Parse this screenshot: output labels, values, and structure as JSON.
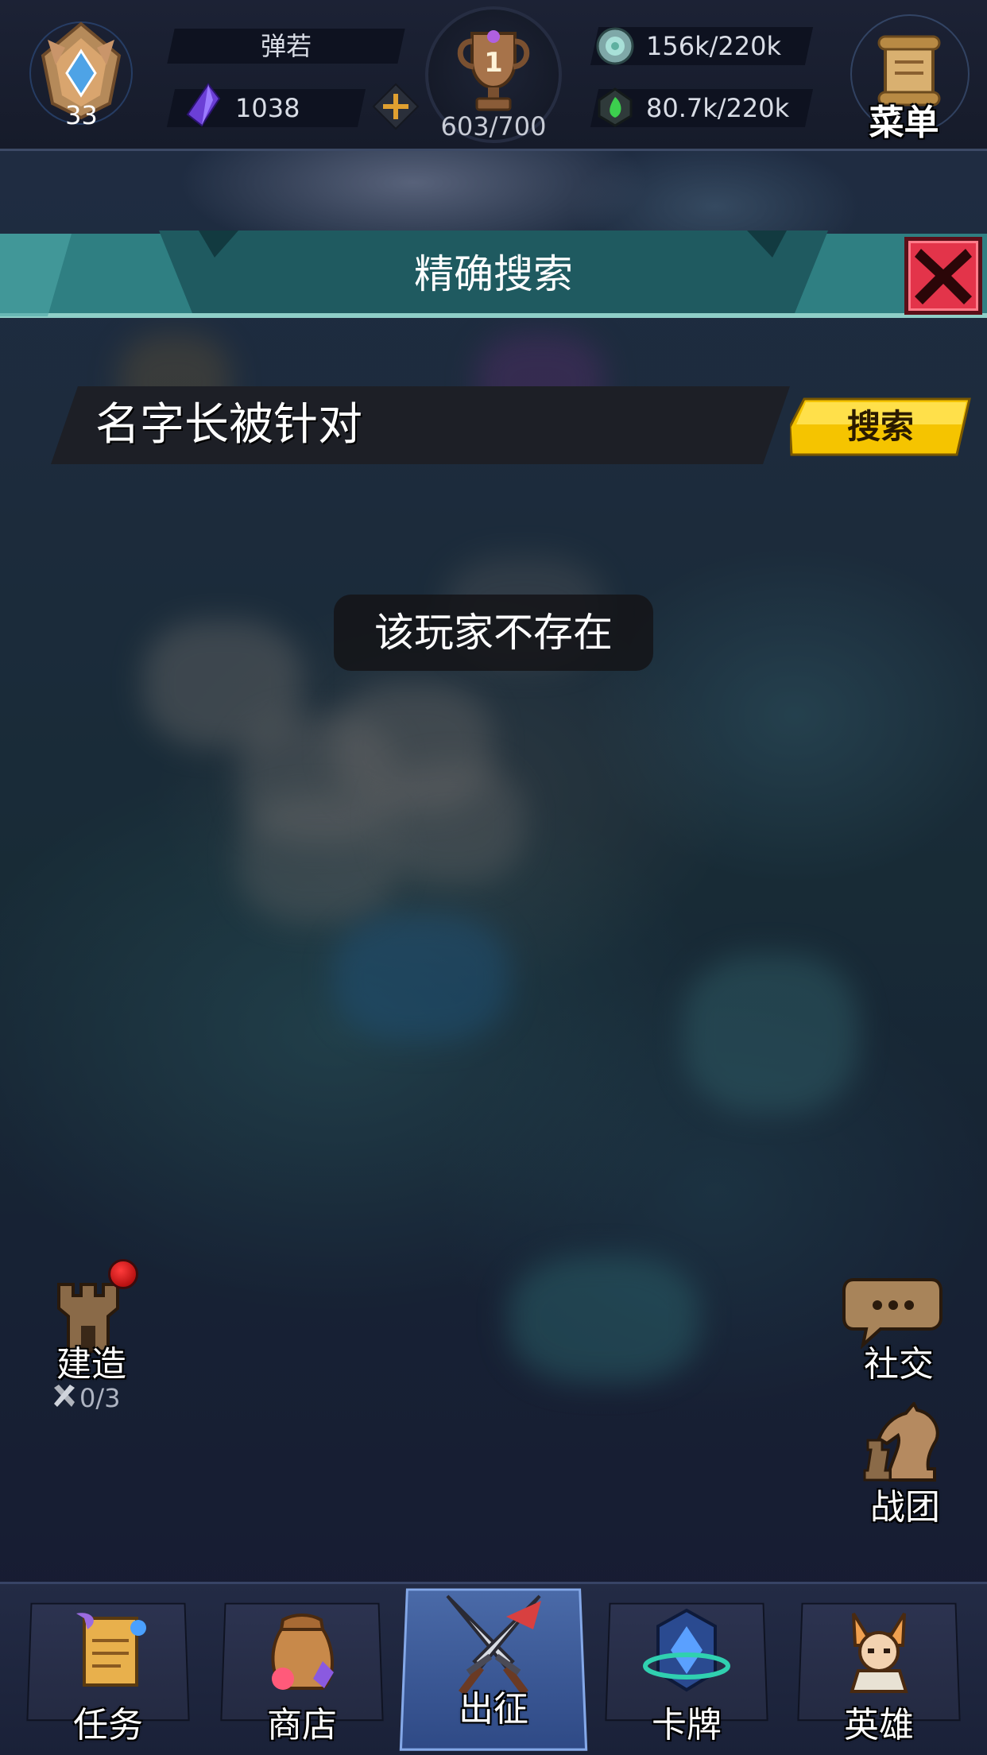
{
  "player": {
    "name": "弹若",
    "level": "33",
    "gems": "1038",
    "trophies": "603/700",
    "trophy_rank": "1"
  },
  "resources": [
    {
      "name": "ore",
      "value": "156k/220k",
      "icon": "ore-icon"
    },
    {
      "name": "elixir",
      "value": "80.7k/220k",
      "icon": "elixir-icon"
    }
  ],
  "menu": {
    "label": "菜单"
  },
  "search_panel": {
    "title": "精确搜索",
    "input_value": "名字长被针对",
    "search_button": "搜索",
    "toast": "该玩家不存在"
  },
  "side_buttons": {
    "build": {
      "label": "建造",
      "count": "0/3"
    },
    "social": {
      "label": "社交"
    },
    "clan": {
      "label": "战团"
    }
  },
  "nav": [
    {
      "label": "任务",
      "icon": "quest-scroll-icon",
      "active": false
    },
    {
      "label": "商店",
      "icon": "shop-bag-icon",
      "active": false
    },
    {
      "label": "出征",
      "icon": "crossed-swords-icon",
      "active": true
    },
    {
      "label": "卡牌",
      "icon": "card-icon",
      "active": false
    },
    {
      "label": "英雄",
      "icon": "hero-icon",
      "active": false
    }
  ],
  "colors": {
    "panel_teal": "#2f7f82",
    "close_red": "#e3344a",
    "search_yellow": "#f5c400",
    "nav_active": "#3b5a9c"
  }
}
